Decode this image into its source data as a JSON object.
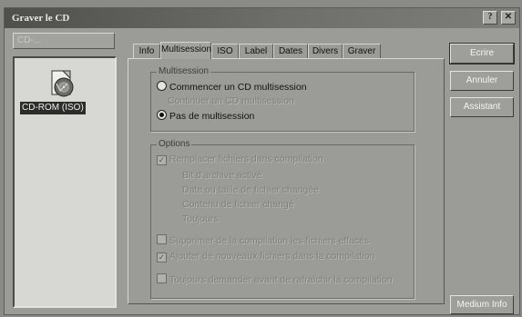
{
  "window": {
    "title": "Graver le CD"
  },
  "drive_select": {
    "value": "CD-..."
  },
  "compilation": {
    "item_label": "CD-ROM (ISO)"
  },
  "tabs": [
    {
      "label": "Info"
    },
    {
      "label": "Multisession"
    },
    {
      "label": "ISO"
    },
    {
      "label": "Label"
    },
    {
      "label": "Dates"
    },
    {
      "label": "Divers"
    },
    {
      "label": "Graver"
    }
  ],
  "multisession": {
    "group_title": "Multisession",
    "start_label": "Commencer un CD multisession",
    "continue_label": "Continuer un CD multisession",
    "none_label": "Pas de multisession",
    "selected": "none"
  },
  "options": {
    "group_title": "Options",
    "replace_label": "Remplacer fichiers dans compilation",
    "sub1": "Bit d'archive activé",
    "sub2": "Date ou taille de fichier changée",
    "sub3": "Contenu de fichier changé",
    "sub4": "Toujours",
    "delete_label": "Supprimer de la compilation les fichiers effacés",
    "add_label": "Ajouter de nouveaux fichiers dans la compilation",
    "ask_label": "Toujours demander avant de rafraîchir la compilation"
  },
  "buttons": {
    "write": "Ecrire",
    "cancel": "Annuler",
    "wizard": "Assistant",
    "info": "Medium Info"
  }
}
